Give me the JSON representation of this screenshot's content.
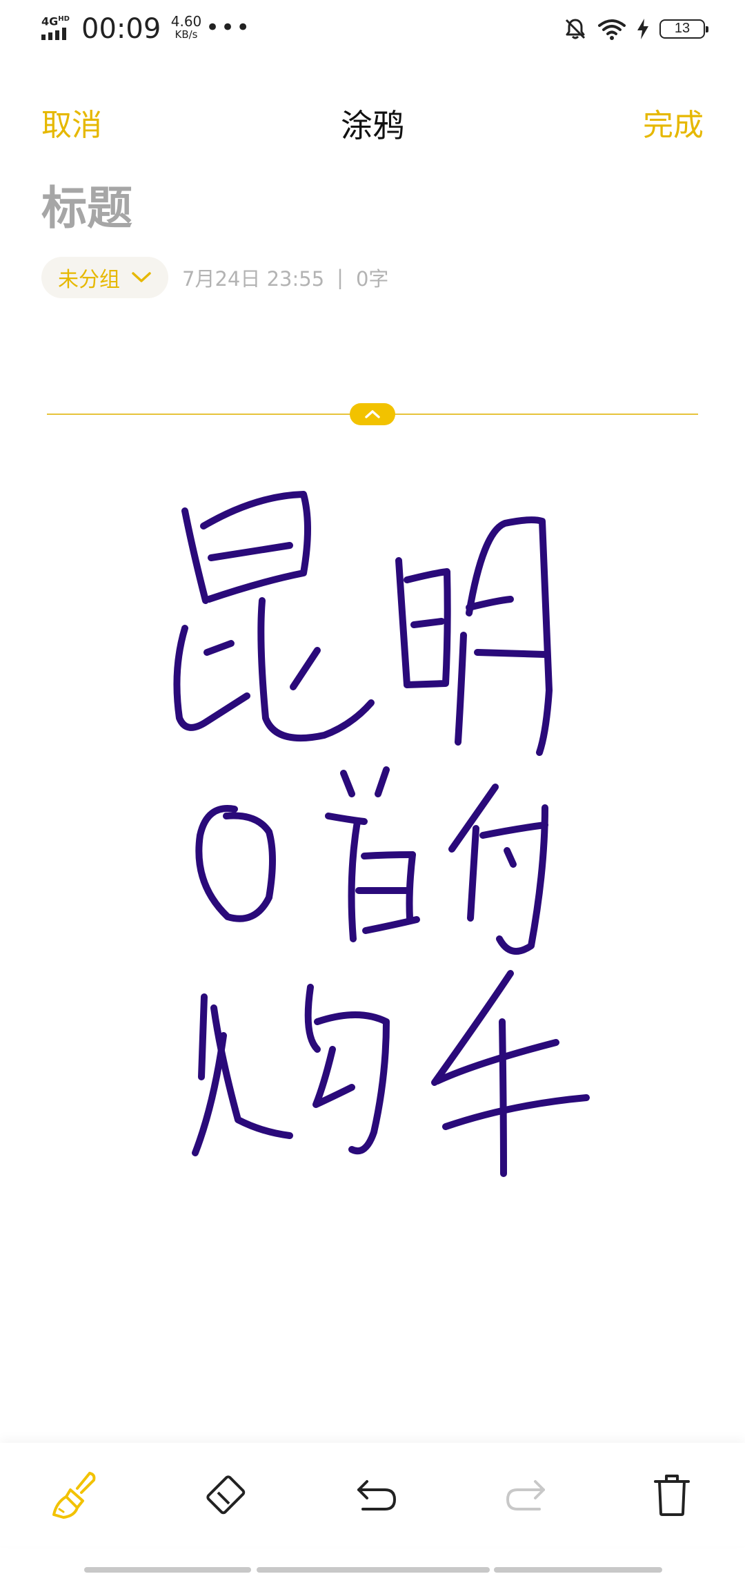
{
  "status_bar": {
    "network": "4G",
    "network_sup": "HD",
    "time": "00:09",
    "speed_value": "4.60",
    "speed_unit": "KB/s",
    "more": "•••",
    "battery": "13"
  },
  "header": {
    "cancel_label": "取消",
    "title": "涂鸦",
    "done_label": "完成"
  },
  "note": {
    "title_placeholder": "标题",
    "group_label": "未分组",
    "date": "7月24日 23:55",
    "separator": "|",
    "word_count": "0字"
  },
  "doodle": {
    "ink_color": "#2a0a7a",
    "handwriting": "昆明0首付购车"
  },
  "toolbar": {
    "tools": [
      "brush-icon",
      "eraser-icon",
      "undo-icon",
      "redo-icon",
      "delete-icon"
    ],
    "active_tool": "brush-icon",
    "accent_color": "#f2c200"
  },
  "colors": {
    "accent": "#e6b800",
    "muted": "#b3b3b3"
  }
}
